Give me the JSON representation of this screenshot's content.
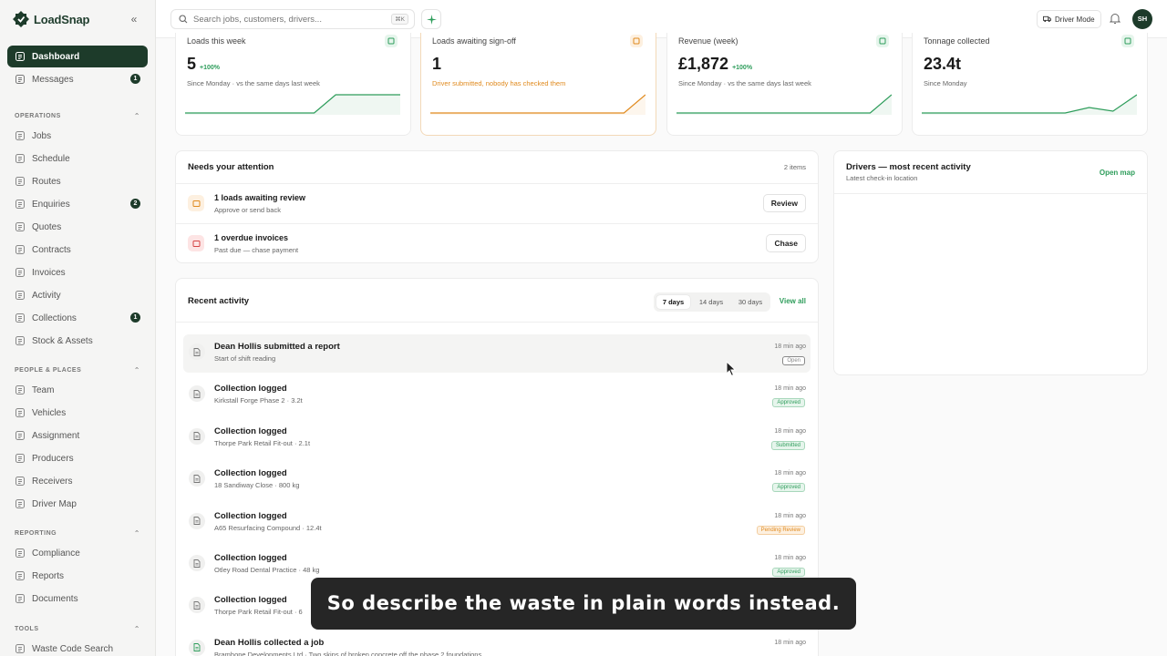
{
  "app": {
    "name": "LoadSnap"
  },
  "sidebar": {
    "top_items": [
      {
        "label": "Dashboard",
        "icon": "grid-icon",
        "active": true
      },
      {
        "label": "Messages",
        "icon": "message-icon",
        "badge": "1"
      }
    ],
    "sections": [
      {
        "title": "OPERATIONS",
        "items": [
          {
            "label": "Jobs"
          },
          {
            "label": "Schedule"
          },
          {
            "label": "Routes"
          },
          {
            "label": "Enquiries",
            "badge": "2"
          },
          {
            "label": "Quotes"
          },
          {
            "label": "Contracts"
          },
          {
            "label": "Invoices"
          },
          {
            "label": "Activity"
          },
          {
            "label": "Collections",
            "badge": "1"
          },
          {
            "label": "Stock & Assets"
          }
        ]
      },
      {
        "title": "PEOPLE & PLACES",
        "items": [
          {
            "label": "Team"
          },
          {
            "label": "Vehicles"
          },
          {
            "label": "Assignment"
          },
          {
            "label": "Producers"
          },
          {
            "label": "Receivers"
          },
          {
            "label": "Driver Map"
          }
        ]
      },
      {
        "title": "REPORTING",
        "items": [
          {
            "label": "Compliance"
          },
          {
            "label": "Reports"
          },
          {
            "label": "Documents"
          }
        ]
      },
      {
        "title": "TOOLS",
        "items": [
          {
            "label": "Waste Code Search"
          }
        ]
      }
    ]
  },
  "topbar": {
    "search_placeholder": "Search jobs, customers, drivers...",
    "search_shortcut": "⌘K",
    "driver_mode_label": "Driver Mode",
    "avatar_initials": "SH"
  },
  "stats": [
    {
      "title": "Loads this week",
      "value": "5",
      "change": "+100%",
      "sub": "Since Monday · vs the same days last week",
      "accent": "#2e9d5b",
      "trend": [
        0,
        0,
        0,
        0,
        0,
        0,
        0,
        1,
        1,
        1,
        1
      ],
      "sub_color": "#666"
    },
    {
      "title": "Loads awaiting sign-off",
      "value": "1",
      "change": "",
      "sub": "Driver submitted, nobody has checked them",
      "accent": "#e08a1e",
      "trend": [
        0,
        0,
        0,
        0,
        0,
        0,
        0,
        0,
        0,
        0,
        1
      ],
      "sub_color": "#e08a1e"
    },
    {
      "title": "Revenue (week)",
      "value": "£1,872",
      "change": "+100%",
      "sub": "Since Monday · vs the same days last week",
      "accent": "#2e9d5b",
      "trend": [
        0,
        0,
        0,
        0,
        0,
        0,
        0,
        0,
        0,
        0,
        1
      ],
      "sub_color": "#666"
    },
    {
      "title": "Tonnage collected",
      "value": "23.4t",
      "change": "",
      "sub": "Since Monday",
      "accent": "#2e9d5b",
      "trend": [
        0,
        0,
        0,
        0,
        0,
        0,
        0,
        0.3,
        0.1,
        1
      ],
      "sub_color": "#666"
    }
  ],
  "attention": {
    "title": "Needs your attention",
    "count": "2 items",
    "items": [
      {
        "title": "1 loads awaiting review",
        "sub": "Approve or send back",
        "button": "Review",
        "color": "#e08a1e",
        "bg": "#fdf0e0"
      },
      {
        "title": "1 overdue invoices",
        "sub": "Past due — chase payment",
        "button": "Chase",
        "color": "#d64545",
        "bg": "#fde4e4"
      }
    ]
  },
  "drivers": {
    "title": "Drivers — most recent activity",
    "sub": "Latest check-in location",
    "link": "Open map"
  },
  "activity": {
    "title": "Recent activity",
    "ranges": [
      "7 days",
      "14 days",
      "30 days"
    ],
    "view_all": "View all",
    "rows": [
      {
        "title": "Dean Hollis submitted a report",
        "desc": "Start of shift reading",
        "time": "18 min ago",
        "badge": "Open",
        "badge_color": "#888",
        "badge_bg": "#fff",
        "highlight": true
      },
      {
        "title": "Collection logged",
        "desc": "Kirkstall Forge Phase 2 · 3.2t",
        "time": "18 min ago",
        "badge": "Approved",
        "badge_color": "#2e9d5b",
        "badge_bg": "#e6f5ec"
      },
      {
        "title": "Collection logged",
        "desc": "Thorpe Park Retail Fit-out · 2.1t",
        "time": "18 min ago",
        "badge": "Submitted",
        "badge_color": "#2e9d5b",
        "badge_bg": "#e6f5ec"
      },
      {
        "title": "Collection logged",
        "desc": "18 Sandiway Close · 800 kg",
        "time": "18 min ago",
        "badge": "Approved",
        "badge_color": "#2e9d5b",
        "badge_bg": "#e6f5ec"
      },
      {
        "title": "Collection logged",
        "desc": "A65 Resurfacing Compound · 12.4t",
        "time": "18 min ago",
        "badge": "Pending Review",
        "badge_color": "#e08a1e",
        "badge_bg": "#fdf0e0"
      },
      {
        "title": "Collection logged",
        "desc": "Otley Road Dental Practice · 48 kg",
        "time": "18 min ago",
        "badge": "Approved",
        "badge_color": "#2e9d5b",
        "badge_bg": "#e6f5ec"
      },
      {
        "title": "Collection logged",
        "desc": "Thorpe Park Retail Fit-out · 6",
        "time": "",
        "badge": "",
        "badge_color": "#2e9d5b",
        "badge_bg": "#e6f5ec"
      },
      {
        "title": "Dean Hollis collected a job",
        "desc": "Bramhope Developments Ltd · Two skips of broken concrete off the phase 2 foundations",
        "time": "18 min ago",
        "badge": "",
        "badge_color": "#2e9d5b",
        "badge_bg": "#e6f5ec"
      }
    ]
  },
  "caption": {
    "text": "So describe the waste in plain words instead."
  }
}
